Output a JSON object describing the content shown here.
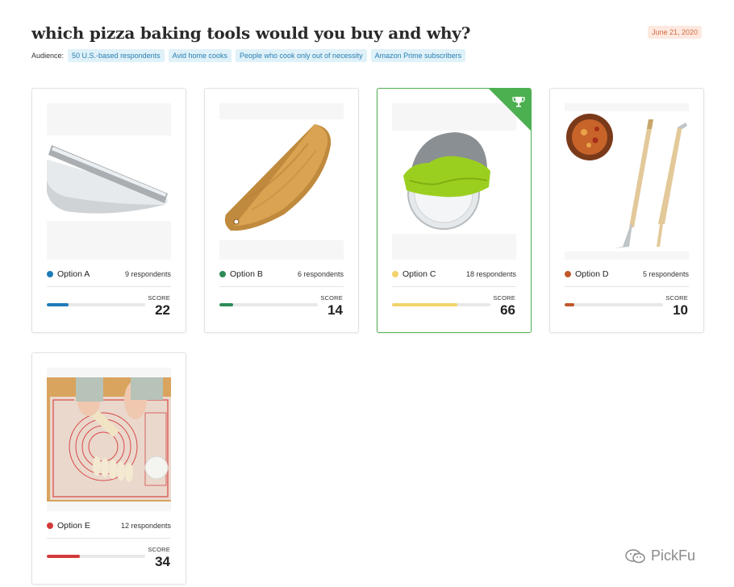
{
  "title": "which pizza baking tools would you buy and why?",
  "date": "June 21, 2020",
  "audience": {
    "label": "Audience:",
    "chips": [
      "50 U.S.-based respondents",
      "Avid home cooks",
      "People who cook only out of necessity",
      "Amazon Prime subscribers"
    ]
  },
  "options": [
    {
      "name": "Option A",
      "respondents": "9 respondents",
      "score_label": "SCORE",
      "score": "22",
      "score_value": 22,
      "color": "#1e7bb8",
      "image_icon": "pizza-rocker-knife-image"
    },
    {
      "name": "Option B",
      "respondents": "6 respondents",
      "score_label": "SCORE",
      "score": "14",
      "score_value": 14,
      "color": "#2e8b57",
      "image_icon": "wooden-rocker-cutter-image"
    },
    {
      "name": "Option C",
      "respondents": "18 respondents",
      "score_label": "SCORE",
      "score": "66",
      "score_value": 66,
      "color": "#f2d36b",
      "image_icon": "pizza-wheel-cutter-image",
      "winner": true
    },
    {
      "name": "Option D",
      "respondents": "5 respondents",
      "score_label": "SCORE",
      "score": "10",
      "score_value": 10,
      "color": "#c0582a",
      "image_icon": "pizza-peel-tools-image"
    },
    {
      "name": "Option E",
      "respondents": "12 respondents",
      "score_label": "SCORE",
      "score": "34",
      "score_value": 34,
      "color": "#d43a3a",
      "image_icon": "silicone-baking-mat-image"
    }
  ],
  "watermark": "PickFu"
}
